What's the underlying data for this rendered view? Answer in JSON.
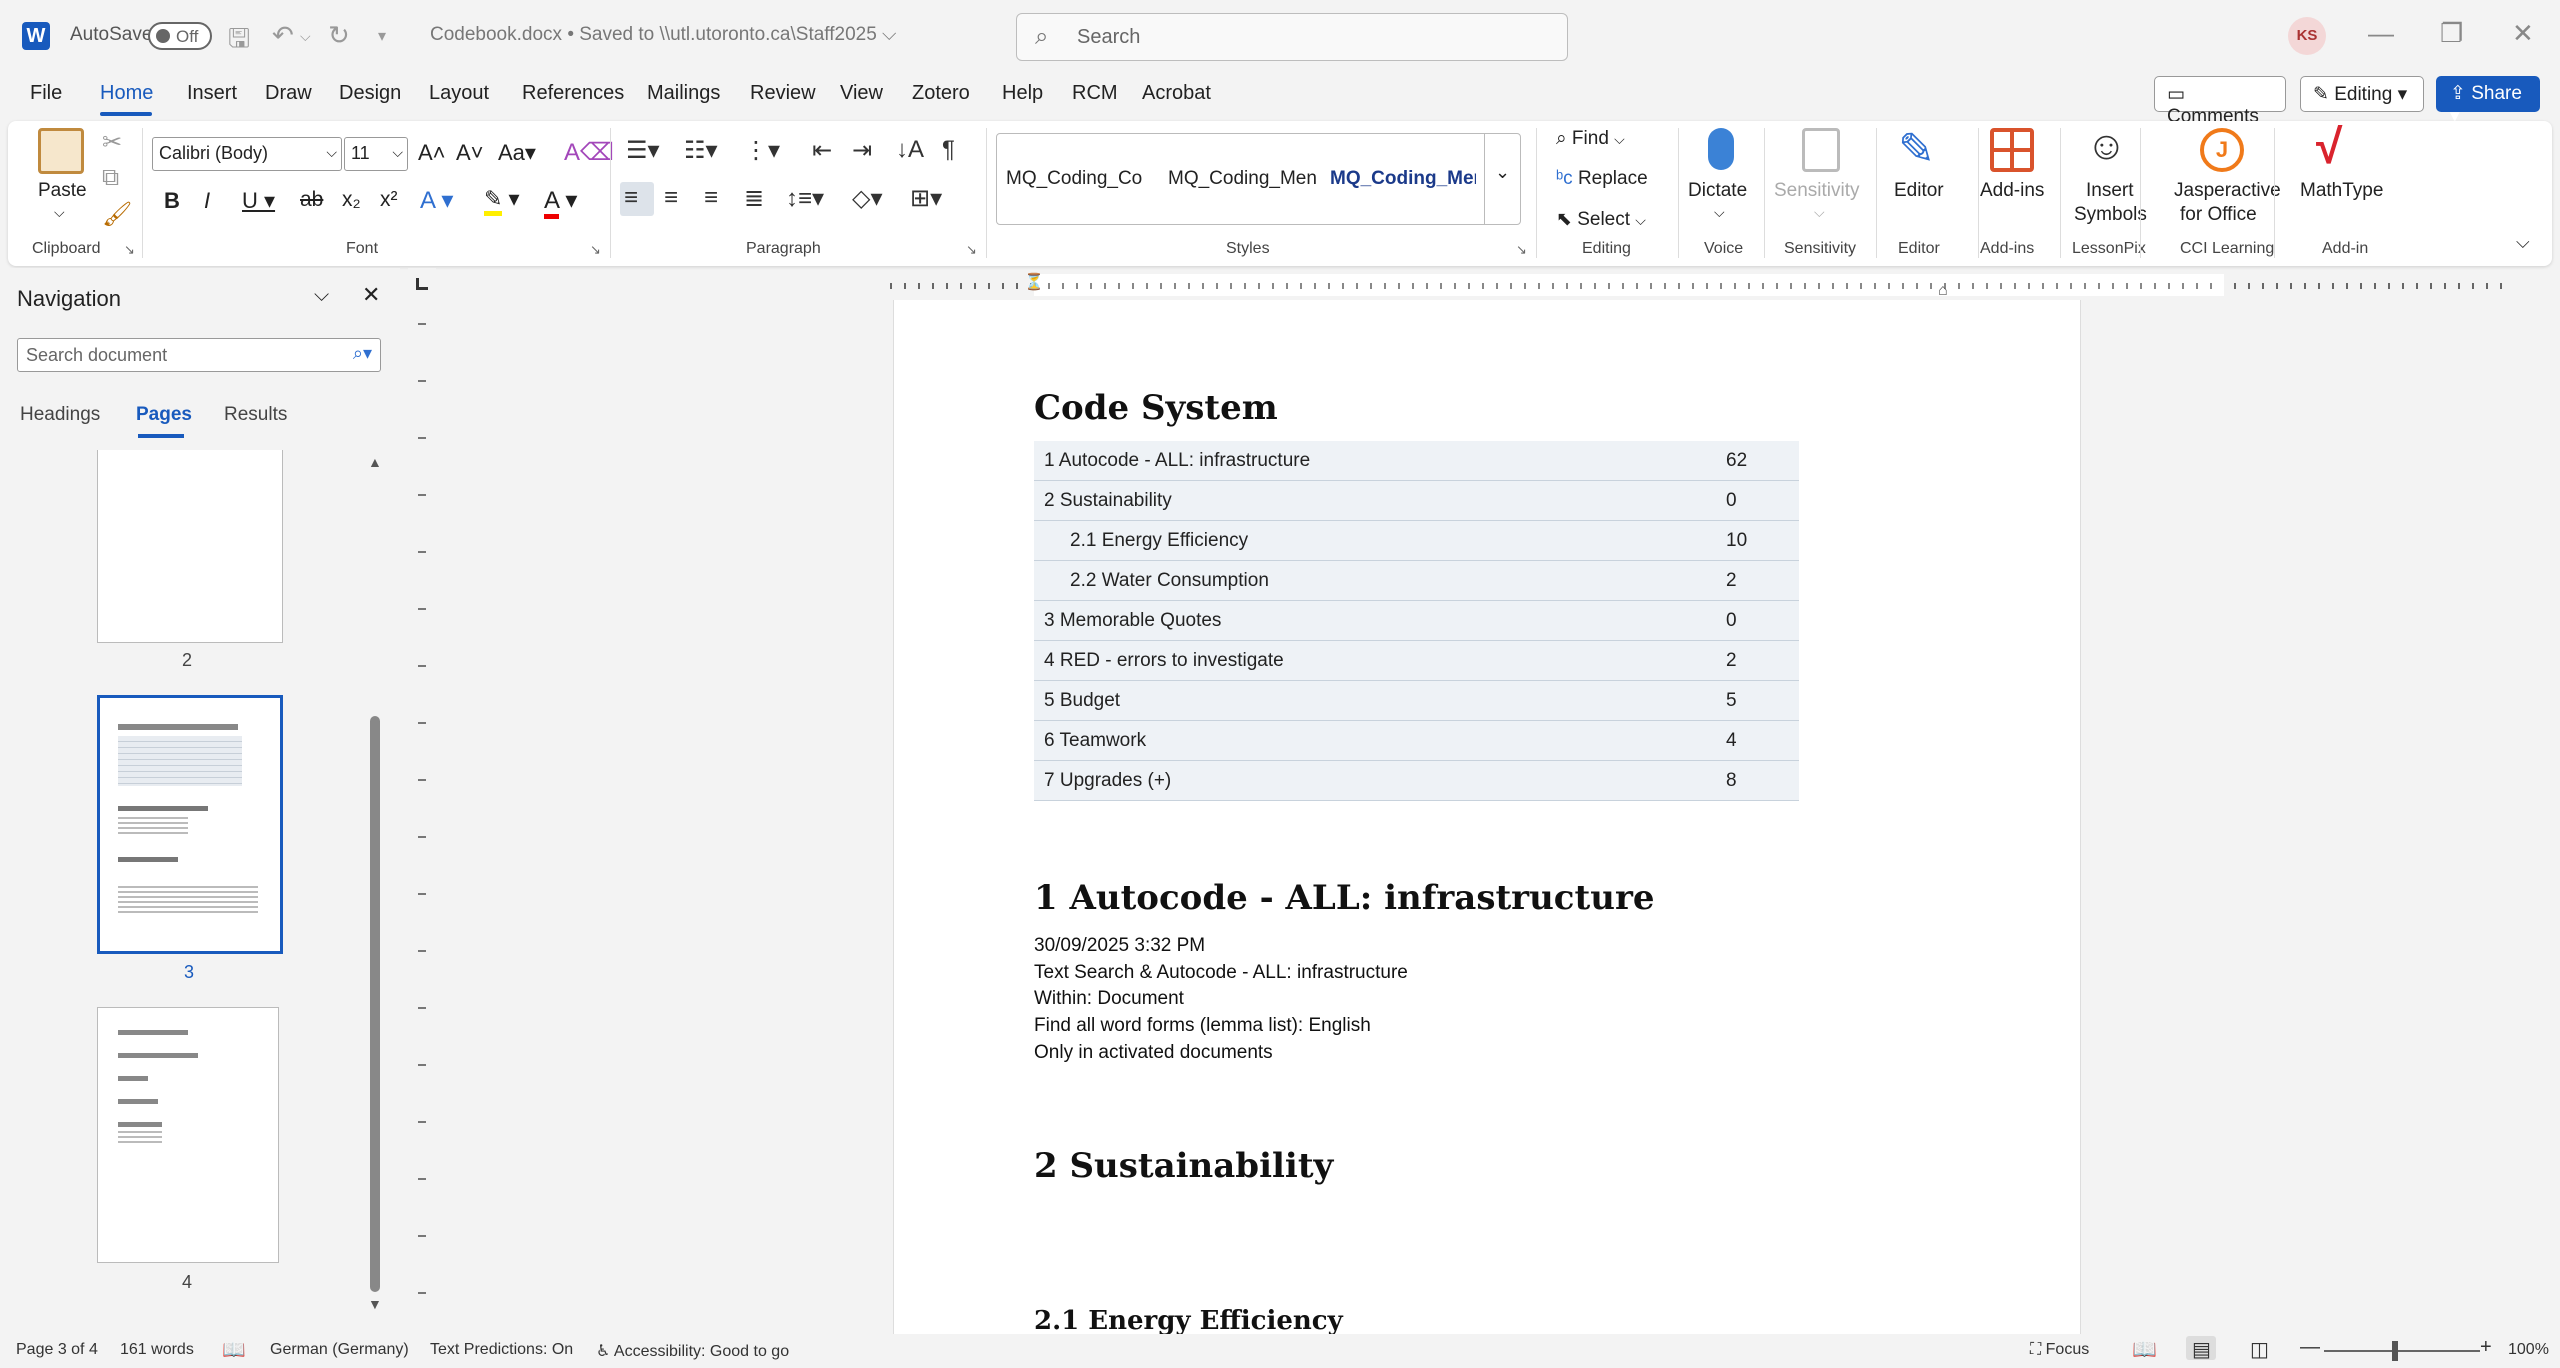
{
  "titlebar": {
    "app_logo": "W",
    "autosave_label": "AutoSave",
    "autosave_state": "Off",
    "doc_title": "Codebook.docx  •  Saved to \\\\utl.utoronto.ca\\Staff2025 ⌵",
    "search_placeholder": "Search",
    "avatar_initials": "KS"
  },
  "menu": {
    "tabs": [
      "File",
      "Home",
      "Insert",
      "Draw",
      "Design",
      "Layout",
      "References",
      "Mailings",
      "Review",
      "View",
      "Zotero",
      "Help",
      "RCM",
      "Acrobat"
    ],
    "active_tab": "Home",
    "comments": "Comments",
    "editing": "Editing",
    "share": "Share"
  },
  "ribbon": {
    "clipboard": {
      "paste": "Paste",
      "label": "Clipboard"
    },
    "font": {
      "name": "Calibri (Body)",
      "size": "11",
      "label": "Font"
    },
    "paragraph": {
      "label": "Paragraph"
    },
    "styles": {
      "items": [
        "MQ_Coding_Co",
        "MQ_Coding_Men",
        "MQ_Coding_Men"
      ],
      "label": "Styles"
    },
    "editing": {
      "find": "Find",
      "replace": "Replace",
      "select": "Select",
      "label": "Editing"
    },
    "voice": {
      "dictate": "Dictate",
      "label": "Voice"
    },
    "sensitivity": {
      "button": "Sensitivity",
      "label": "Sensitivity"
    },
    "editor": {
      "button": "Editor",
      "label": "Editor"
    },
    "addins": {
      "button": "Add-ins",
      "label": "Add-ins"
    },
    "lessonpix": {
      "button_l1": "Insert",
      "button_l2": "Symbols",
      "label": "LessonPix"
    },
    "cci": {
      "button_l1": "Jasperactive",
      "button_l2": "for Office",
      "label": "CCI Learning"
    },
    "mathtype": {
      "button": "MathType",
      "label": "Add-in"
    }
  },
  "nav": {
    "title": "Navigation",
    "search_placeholder": "Search document",
    "tabs": [
      "Headings",
      "Pages",
      "Results"
    ],
    "active_tab": "Pages",
    "page_numbers": [
      "2",
      "3",
      "4"
    ]
  },
  "document": {
    "code_system_title": "Code System",
    "codes": [
      {
        "name": "1 Autocode - ALL: infrastructure",
        "count": "62",
        "indent": 0
      },
      {
        "name": "2 Sustainability",
        "count": "0",
        "indent": 0
      },
      {
        "name": "2.1 Energy Efficiency",
        "count": "10",
        "indent": 1
      },
      {
        "name": "2.2 Water Consumption",
        "count": "2",
        "indent": 1
      },
      {
        "name": "3 Memorable Quotes",
        "count": "0",
        "indent": 0
      },
      {
        "name": "4 RED - errors to investigate",
        "count": "2",
        "indent": 0
      },
      {
        "name": "5 Budget",
        "count": "5",
        "indent": 0
      },
      {
        "name": "6 Teamwork",
        "count": "4",
        "indent": 0
      },
      {
        "name": "7 Upgrades (+)",
        "count": "8",
        "indent": 0
      }
    ],
    "section1_title": "1 Autocode - ALL: infrastructure",
    "section1_lines": [
      "30/09/2025 3:32 PM",
      "Text Search & Autocode - ALL: infrastructure",
      "Within: Document",
      "Find all word forms (lemma list): English",
      "Only in activated documents"
    ],
    "section2_title": "2 Sustainability",
    "section21_title": "2.1 Energy Efficiency"
  },
  "status": {
    "page": "Page 3 of 4",
    "words": "161 words",
    "language": "German (Germany)",
    "predictions": "Text Predictions: On",
    "accessibility": "Accessibility: Good to go",
    "focus": "Focus",
    "zoom": "100%"
  },
  "colors": {
    "accent": "#185abd",
    "table_row": "#eef2f6"
  }
}
